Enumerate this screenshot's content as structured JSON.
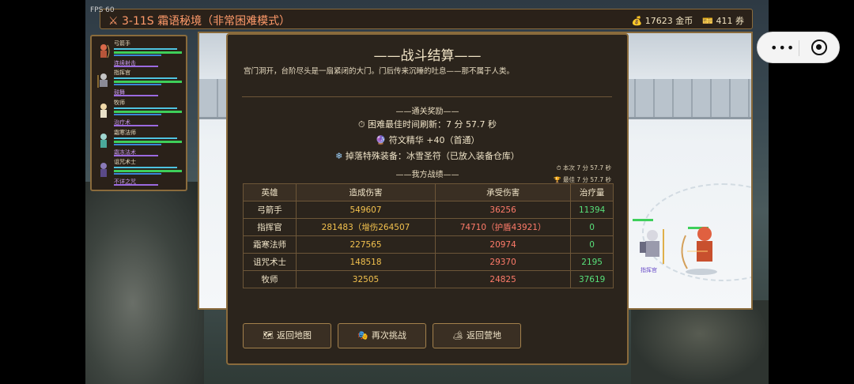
{
  "hud": {
    "fps": "FPS 60",
    "stage_title": "⚔ 3-11S 霜语秘境（非常困难模式）",
    "gold": "17623 金币",
    "tickets": "411 券"
  },
  "party": [
    {
      "name": "弓箭手",
      "skill": "连续射击"
    },
    {
      "name": "指挥官",
      "skill": "鼓舞"
    },
    {
      "name": "牧师",
      "skill": "治疗术"
    },
    {
      "name": "霜寒法师",
      "skill": "霜冻法术"
    },
    {
      "name": "诅咒术士",
      "skill": "不详之咒"
    }
  ],
  "battlefield": {
    "unit_label": "指挥官"
  },
  "result": {
    "title": "——战斗结算——",
    "description": "宫门洞开，台阶尽头是一扇紧闭的大门。门后传来沉睡的吐息——那不属于人类。",
    "rewards_header": "——通关奖励——",
    "best_time": "⏱ 困难最佳时间刷新：7 分 57.7 秒",
    "rune": "符文精华 +40（首通）",
    "drop": "掉落特殊装备：冰雪圣符（已放入装备仓库）",
    "stats_header": "——我方战绩——",
    "this_time": "⏱ 本次 7 分 57.7 秒",
    "best": "🏆 最佳 7 分 57.7 秒",
    "columns": [
      "英雄",
      "造成伤害",
      "承受伤害",
      "治疗量"
    ],
    "rows": [
      [
        "弓箭手",
        "549607",
        "36256",
        "11394"
      ],
      [
        "指挥官",
        "281483（增伤264507",
        "74710（护盾43921）",
        "0"
      ],
      [
        "霜寒法师",
        "227565",
        "20974",
        "0"
      ],
      [
        "诅咒术士",
        "148518",
        "29370",
        "2195"
      ],
      [
        "牧师",
        "32505",
        "24825",
        "37619"
      ]
    ],
    "buttons": {
      "back_map": "返回地图",
      "retry": "再次挑战",
      "back_camp": "返回营地"
    }
  },
  "miniprogram": {
    "more": "•••"
  },
  "colors": {
    "panel_bg": "#2b241c",
    "border": "#8a6b3c",
    "damage": "#f2c14e",
    "taken": "#ff7b6a",
    "heal": "#58e07a"
  }
}
